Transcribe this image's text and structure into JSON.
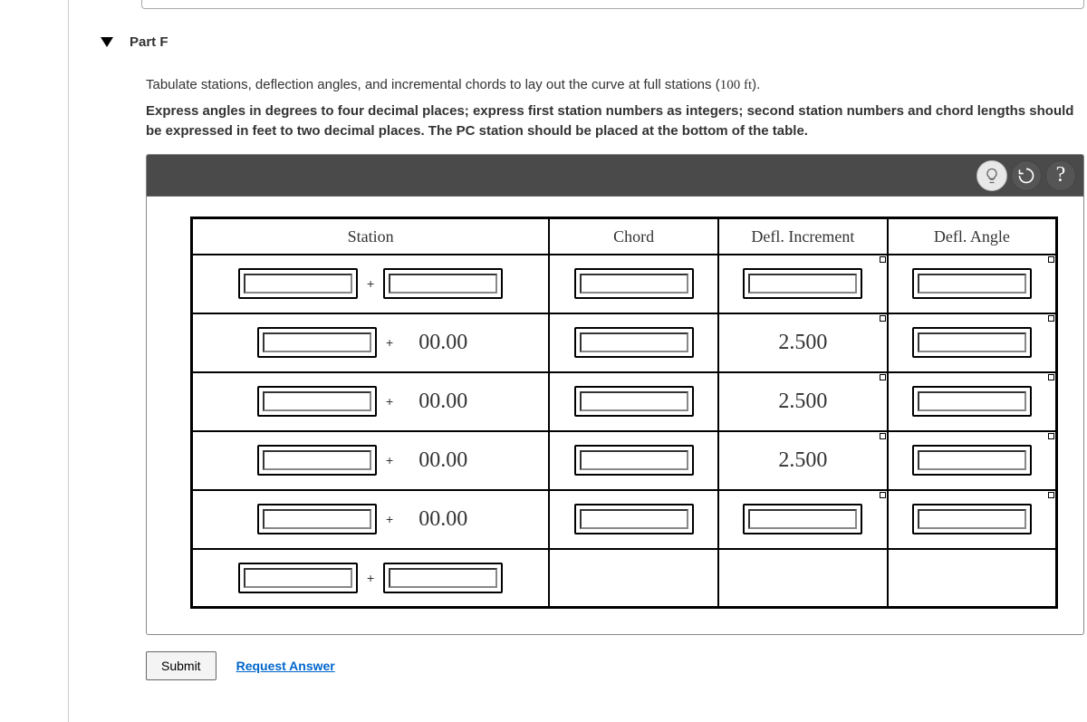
{
  "part": {
    "label": "Part F"
  },
  "instructions": {
    "line1_a": "Tabulate stations, deflection angles, and incremental chords to lay out the curve at full stations (",
    "line1_unit": "100 ft",
    "line1_b": ").",
    "line2": "Express angles in degrees to four decimal places; express first station numbers as integers; second station numbers and chord lengths should be expressed in feet to two decimal places. The PC station should be placed at the bottom of the table."
  },
  "headers": {
    "station": "Station",
    "chord": "Chord",
    "incr": "Defl. Increment",
    "angle": "Defl. Angle"
  },
  "rows": [
    {
      "st1": "",
      "plus": "+",
      "st2": "",
      "st2_input": true,
      "chord_input": true,
      "incr": "",
      "incr_input": true,
      "angle_input": true,
      "has_corner": true
    },
    {
      "st1": "",
      "plus": "+",
      "st2": "00.00",
      "st2_input": false,
      "chord_input": true,
      "incr": "2.500",
      "incr_input": false,
      "angle_input": true,
      "has_corner": true
    },
    {
      "st1": "",
      "plus": "+",
      "st2": "00.00",
      "st2_input": false,
      "chord_input": true,
      "incr": "2.500",
      "incr_input": false,
      "angle_input": true,
      "has_corner": true
    },
    {
      "st1": "",
      "plus": "+",
      "st2": "00.00",
      "st2_input": false,
      "chord_input": true,
      "incr": "2.500",
      "incr_input": false,
      "angle_input": true,
      "has_corner": true
    },
    {
      "st1": "",
      "plus": "+",
      "st2": "00.00",
      "st2_input": false,
      "chord_input": true,
      "incr": "",
      "incr_input": true,
      "angle_input": true,
      "has_corner": true
    },
    {
      "st1": "",
      "plus": "+",
      "st2": "",
      "st2_input": true,
      "chord_input": false,
      "incr": "",
      "incr_input": false,
      "angle_input": false,
      "has_corner": false
    }
  ],
  "buttons": {
    "submit": "Submit",
    "request": "Request Answer"
  }
}
